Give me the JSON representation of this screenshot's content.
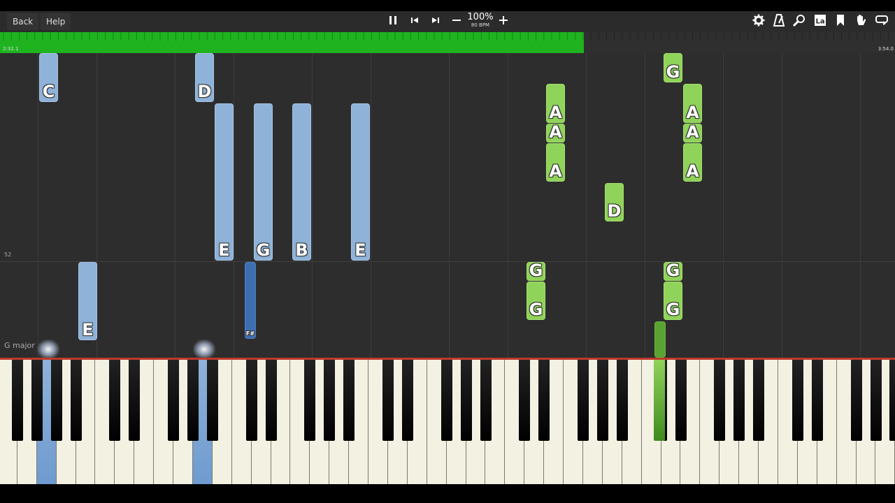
{
  "toolbar": {
    "back_label": "Back",
    "help_label": "Help",
    "zoom_percent": "100%",
    "tempo": "80 BPM",
    "icons": [
      "pause-icon",
      "skip-back-icon",
      "skip-forward-icon",
      "minus-icon",
      "plus-icon",
      "settings-gear-icon",
      "metronome-icon",
      "magnifier-icon",
      "note-labels-icon",
      "bookmark-icon",
      "hand-icon",
      "loop-icon"
    ]
  },
  "progress": {
    "current_time": "2:32.1",
    "total_time": "3:54.0",
    "fraction": 0.652,
    "color": "#1fb31f"
  },
  "roll": {
    "measure_number": "52",
    "key_signature": "G major",
    "colors": {
      "left_hand": "#8eb2d8",
      "left_hand_sharp": "#3e6fb2",
      "right_hand": "#90d35a"
    }
  },
  "notes": {
    "c1": "C",
    "d1": "D",
    "e1": "E",
    "g1": "G",
    "b1": "B",
    "e2": "E",
    "e3": "E",
    "fs1": "F#",
    "a1": "A",
    "a2": "A",
    "a3": "A",
    "g2": "G",
    "g3": "G",
    "d2": "D",
    "g4": "G",
    "a4": "A",
    "a5": "A",
    "a6": "A",
    "g5": "G",
    "g6": "G"
  }
}
